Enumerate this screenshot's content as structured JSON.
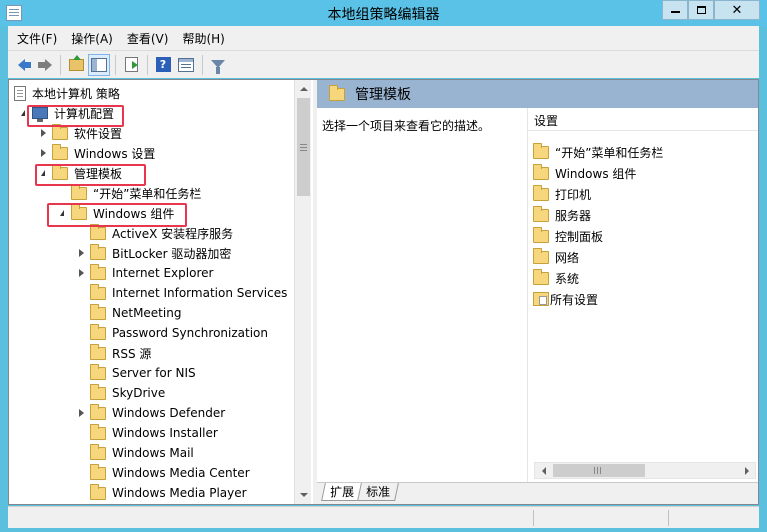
{
  "window": {
    "title": "本地组策略编辑器",
    "minimize": "minimize",
    "maximize": "maximize",
    "close": "✕"
  },
  "menu": [
    "文件(F)",
    "操作(A)",
    "查看(V)",
    "帮助(H)"
  ],
  "toolbar_icons": [
    "back-icon",
    "forward-icon",
    "up-folder-icon",
    "show-hide-tree-icon",
    "export-list-icon",
    "help-icon",
    "properties-icon",
    "filter-icon"
  ],
  "tree": {
    "root": "本地计算机 策略",
    "items": [
      {
        "label": "计算机配置",
        "level": 1,
        "expander": "open",
        "icon": "computer-icon",
        "highlighted": true
      },
      {
        "label": "软件设置",
        "level": 2,
        "expander": "closed",
        "icon": "folder-icon"
      },
      {
        "label": "Windows 设置",
        "level": 2,
        "expander": "closed",
        "icon": "folder-icon"
      },
      {
        "label": "管理模板",
        "level": 2,
        "expander": "open",
        "icon": "folder-icon",
        "highlighted": true
      },
      {
        "label": "“开始”菜单和任务栏",
        "level": 3,
        "expander": "none",
        "icon": "folder-icon"
      },
      {
        "label": "Windows 组件",
        "level": 3,
        "expander": "open",
        "icon": "folder-icon",
        "highlighted": true
      },
      {
        "label": "ActiveX 安装程序服务",
        "level": 4,
        "expander": "none",
        "icon": "folder-icon"
      },
      {
        "label": "BitLocker 驱动器加密",
        "level": 4,
        "expander": "closed",
        "icon": "folder-icon"
      },
      {
        "label": "Internet Explorer",
        "level": 4,
        "expander": "closed",
        "icon": "folder-icon"
      },
      {
        "label": "Internet Information Services",
        "level": 4,
        "expander": "none",
        "icon": "folder-icon"
      },
      {
        "label": "NetMeeting",
        "level": 4,
        "expander": "none",
        "icon": "folder-icon"
      },
      {
        "label": "Password Synchronization",
        "level": 4,
        "expander": "none",
        "icon": "folder-icon"
      },
      {
        "label": "RSS 源",
        "level": 4,
        "expander": "none",
        "icon": "folder-icon"
      },
      {
        "label": "Server for NIS",
        "level": 4,
        "expander": "none",
        "icon": "folder-icon"
      },
      {
        "label": "SkyDrive",
        "level": 4,
        "expander": "none",
        "icon": "folder-icon"
      },
      {
        "label": "Windows Defender",
        "level": 4,
        "expander": "closed",
        "icon": "folder-icon"
      },
      {
        "label": "Windows Installer",
        "level": 4,
        "expander": "none",
        "icon": "folder-icon"
      },
      {
        "label": "Windows Mail",
        "level": 4,
        "expander": "none",
        "icon": "folder-icon"
      },
      {
        "label": "Windows Media Center",
        "level": 4,
        "expander": "none",
        "icon": "folder-icon"
      },
      {
        "label": "Windows Media Player",
        "level": 4,
        "expander": "none",
        "icon": "folder-icon"
      }
    ]
  },
  "right_pane": {
    "header": "管理模板",
    "description": "选择一个项目来查看它的描述。",
    "column_header": "设置",
    "items": [
      "“开始”菜单和任务栏",
      "Windows 组件",
      "打印机",
      "服务器",
      "控制面板",
      "网络",
      "系统",
      "所有设置"
    ],
    "tabs": [
      "扩展",
      "标准"
    ]
  },
  "colors": {
    "title_bar": "#5bc2e7",
    "header_band": "#99b4d1",
    "highlight_box": "#e8364e"
  }
}
